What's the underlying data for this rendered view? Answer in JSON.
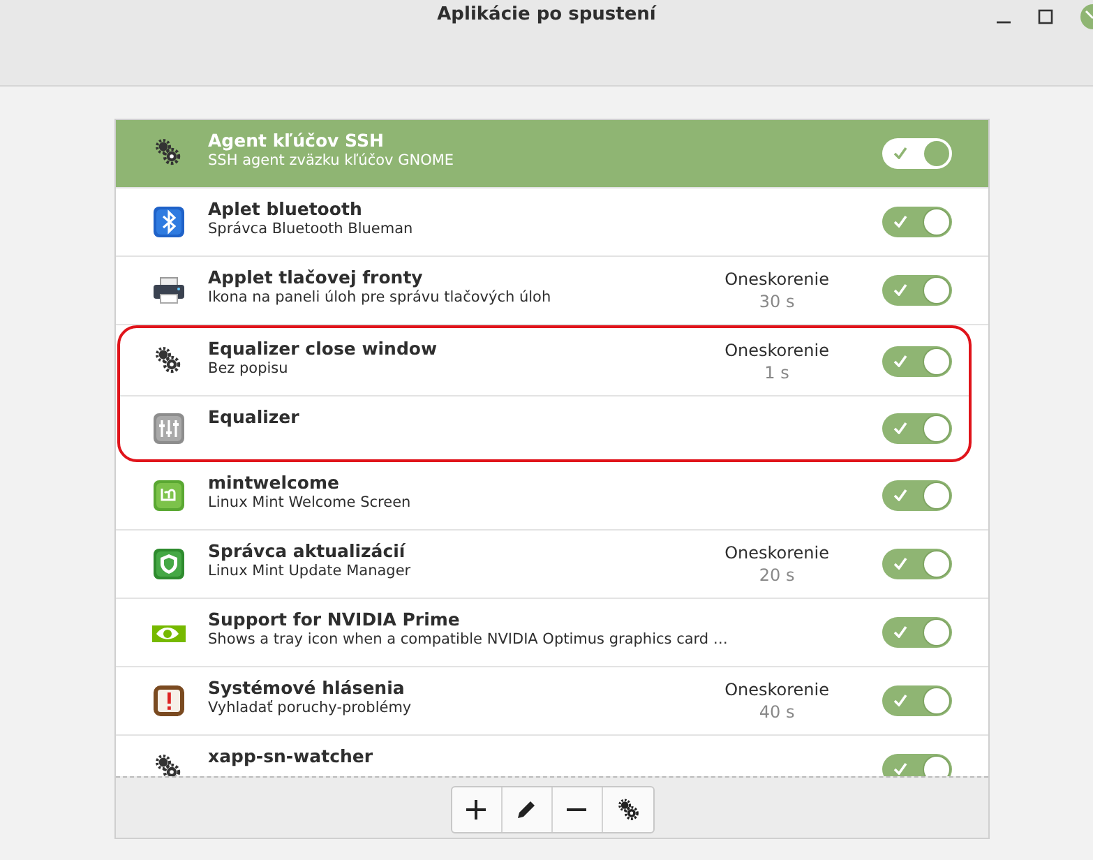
{
  "window": {
    "title": "Aplikácie po spustení"
  },
  "rows": [
    {
      "name": "Agent kľúčov SSH",
      "description": "SSH agent zväzku kľúčov GNOME",
      "selected": true,
      "enabled": true,
      "outlined": false
    },
    {
      "name": "Aplet bluetooth",
      "description": "Správca Bluetooth Blueman",
      "selected": false,
      "enabled": true,
      "outlined": false
    },
    {
      "name": "Applet tlačovej fronty",
      "description": "Ikona na paneli úloh pre správu tlačových úloh",
      "delay_label": "Oneskorenie",
      "delay": "30 s",
      "selected": false,
      "enabled": true,
      "outlined": false
    },
    {
      "name": "Equalizer close window",
      "description": "Bez popisu",
      "delay_label": "Oneskorenie",
      "delay": "1 s",
      "selected": false,
      "enabled": true,
      "outlined": true
    },
    {
      "name": "Equalizer",
      "selected": false,
      "enabled": true,
      "outlined": true
    },
    {
      "name": "mintwelcome",
      "description": "Linux Mint Welcome Screen",
      "selected": false,
      "enabled": true,
      "outlined": false
    },
    {
      "name": "Správca aktualizácií",
      "description": "Linux Mint Update Manager",
      "delay_label": "Oneskorenie",
      "delay": "20 s",
      "selected": false,
      "enabled": true,
      "outlined": false
    },
    {
      "name": "Support for NVIDIA Prime",
      "description": "Shows a tray icon when a compatible NVIDIA Optimus graphics card …",
      "selected": false,
      "enabled": true,
      "outlined": false
    },
    {
      "name": "Systémové hlásenia",
      "description": "Vyhladať poruchy-problémy",
      "delay_label": "Oneskorenie",
      "delay": "40 s",
      "selected": false,
      "enabled": true,
      "outlined": false
    },
    {
      "name": "xapp-sn-watcher",
      "selected": false,
      "enabled": true,
      "outlined": false
    }
  ]
}
